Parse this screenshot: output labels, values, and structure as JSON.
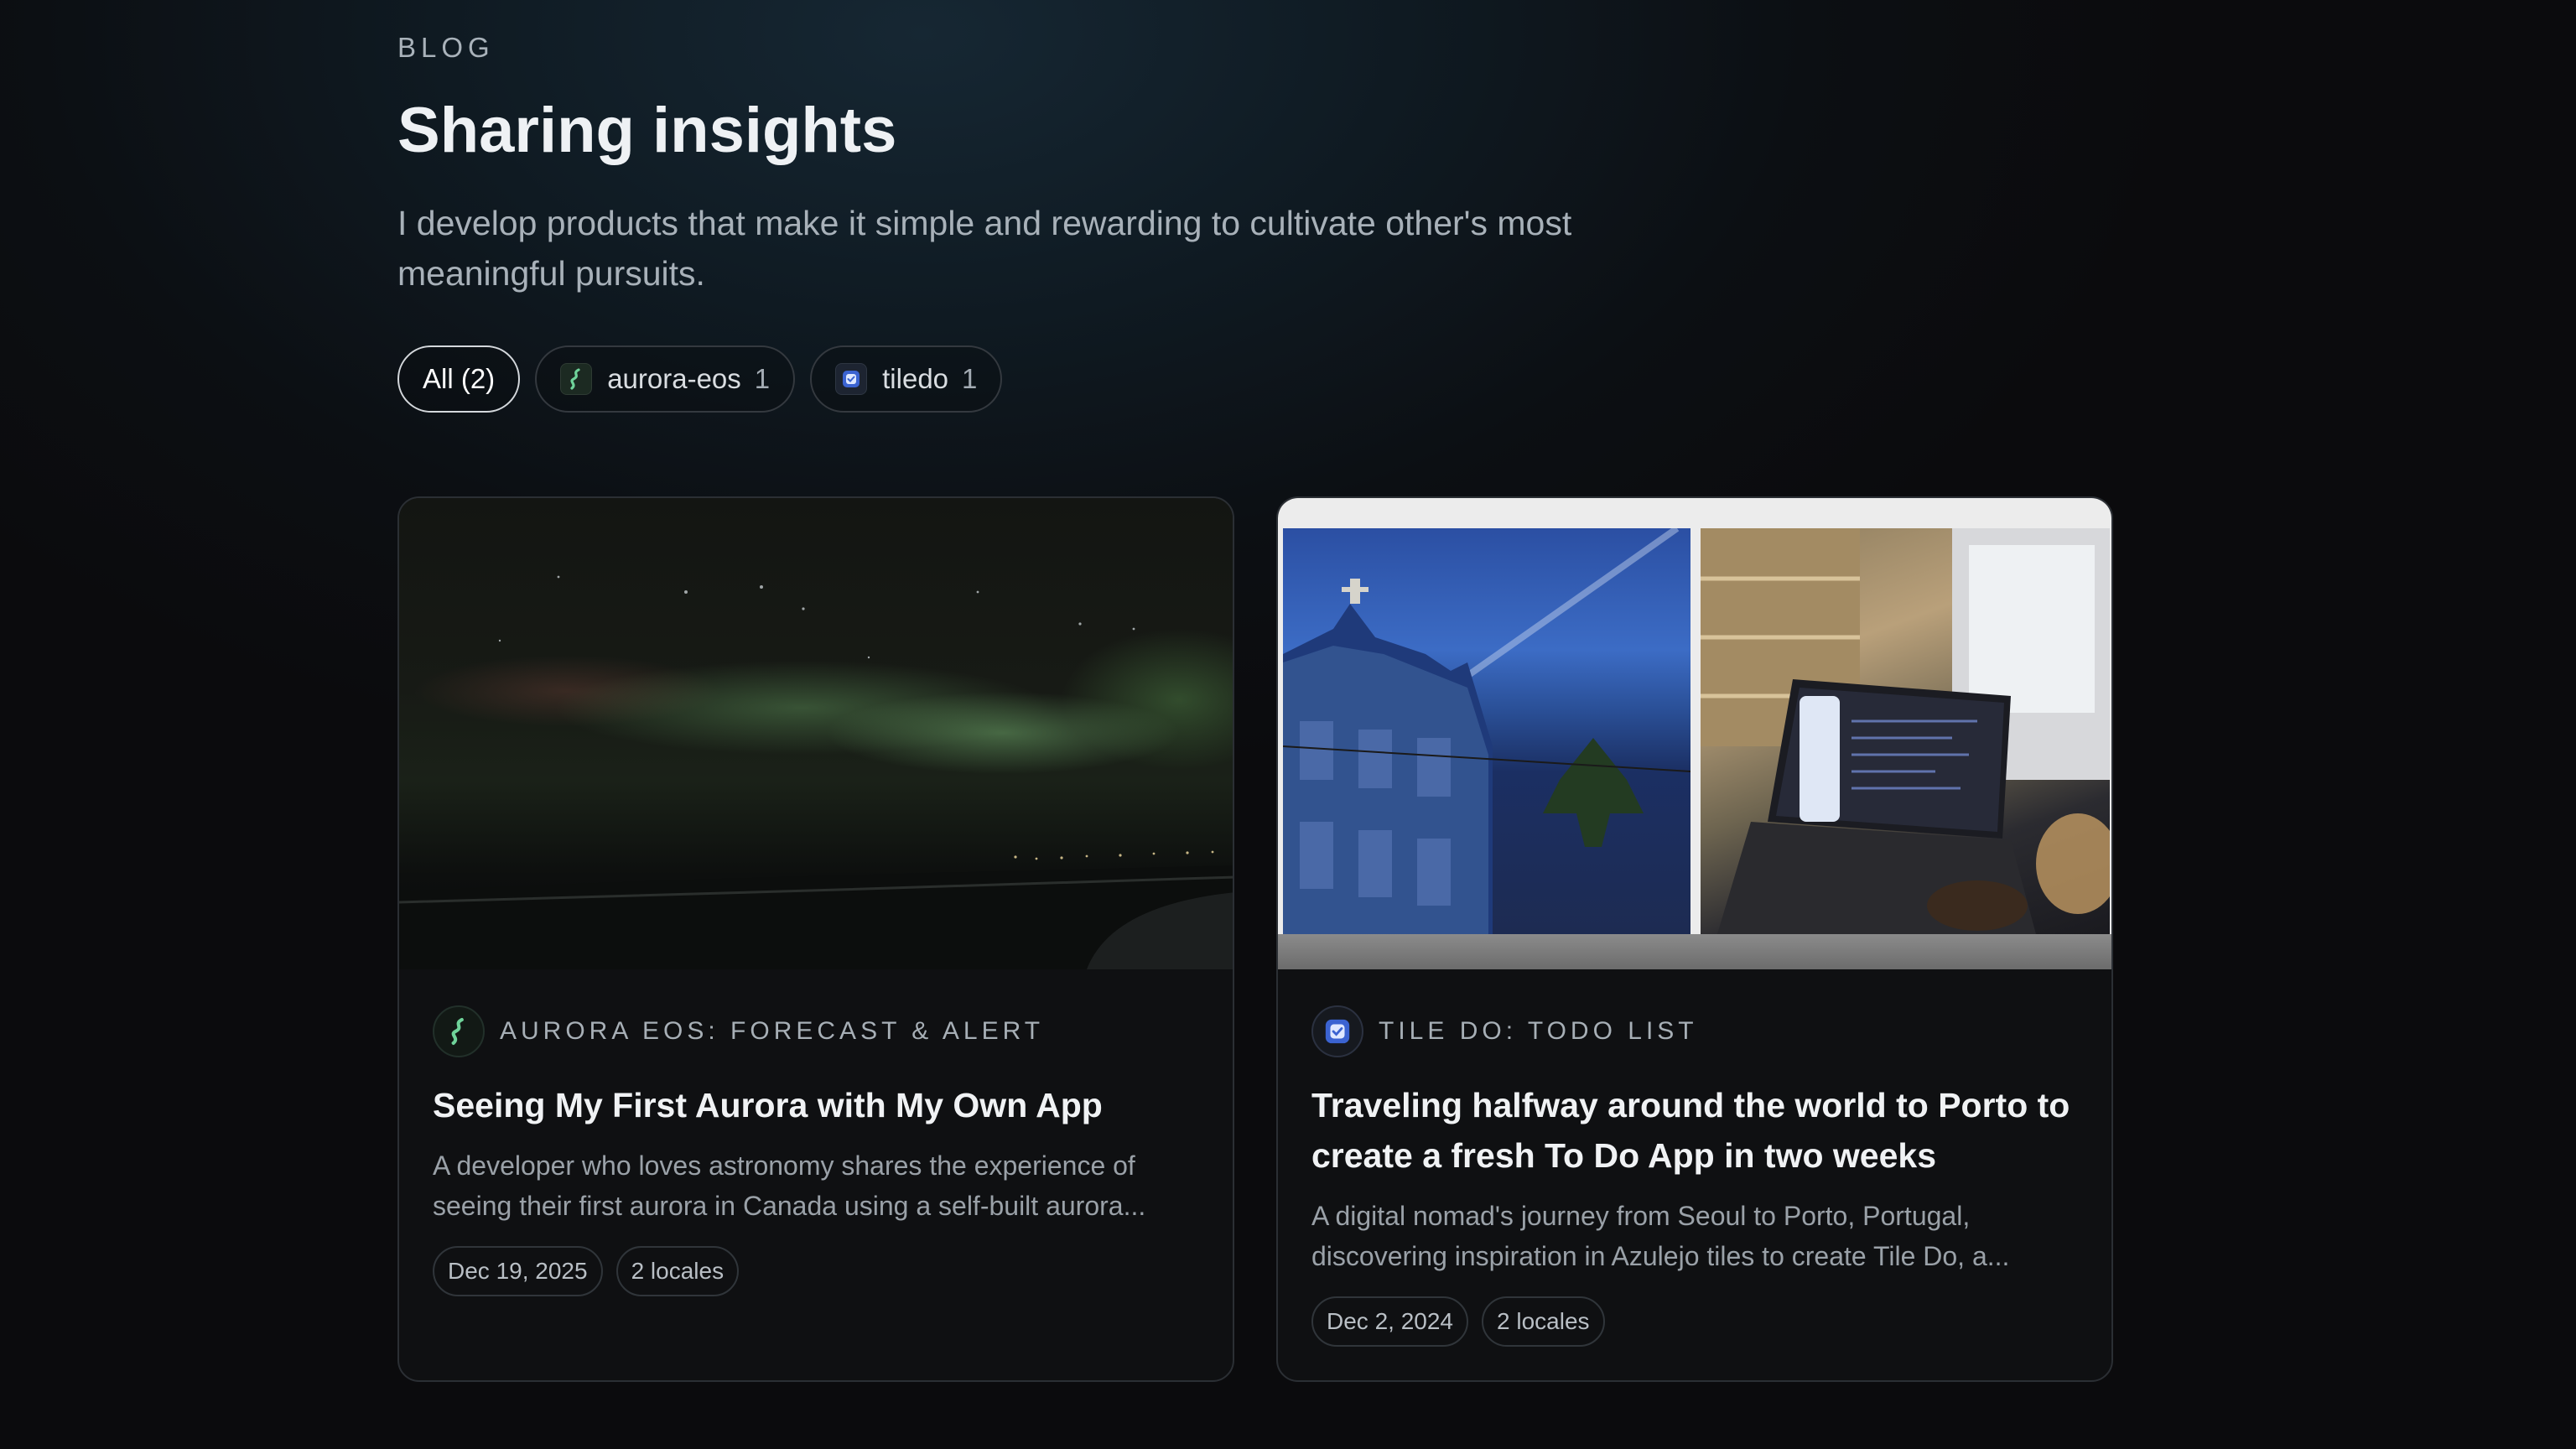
{
  "header": {
    "eyebrow": "BLOG",
    "title": "Sharing insights",
    "subtitle": "I develop products that make it simple and rewarding to cultivate other's most meaningful pursuits."
  },
  "filters": [
    {
      "label": "All (2)",
      "count": "",
      "icon": "",
      "active": true
    },
    {
      "label": "aurora-eos",
      "count": "1",
      "icon": "aurora-eos-app-icon",
      "active": false
    },
    {
      "label": "tiledo",
      "count": "1",
      "icon": "tiledo-app-icon",
      "active": false
    }
  ],
  "posts": [
    {
      "app_name": "AURORA EOS: FORECAST & ALERT",
      "app_icon": "aurora-eos-app-icon",
      "title": "Seeing My First Aurora with My Own App",
      "description": "A developer who loves astronomy shares the experience of seeing their first aurora in Canada using a self-built aurora...",
      "date": "Dec 19, 2025",
      "locales": "2 locales",
      "image": "northern-lights-night-sky-photo"
    },
    {
      "app_name": "TILE DO: TODO LIST",
      "app_icon": "tiledo-app-icon",
      "title": "Traveling halfway around the world to Porto to create a fresh To Do App in two weeks",
      "description": "A digital nomad's journey from Seoul to Porto, Portugal, discovering inspiration in Azulejo tiles to create Tile Do, a...",
      "date": "Dec 2, 2024",
      "locales": "2 locales",
      "image": "porto-azulejo-church-and-laptop-photos"
    }
  ],
  "colors": {
    "background": "#0b0b0d",
    "card_border": "#2b2f34",
    "accent_aurora": "#6fd39a",
    "accent_tiledo": "#4a6fd6"
  }
}
